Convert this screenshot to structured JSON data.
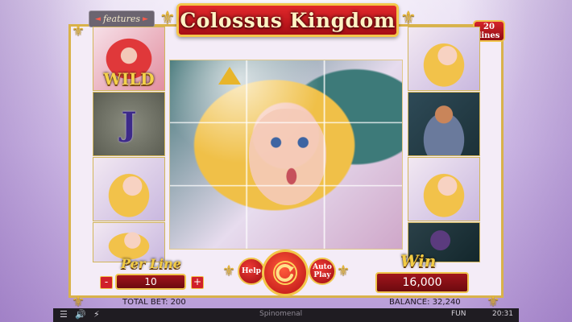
{
  "game": {
    "title": "Colossus Kingdom",
    "lines_badge": "20 lines",
    "features_label": "features",
    "wild_label": "WILD",
    "j_symbol": "J"
  },
  "reels": {
    "left": [
      "wizard-wild",
      "j",
      "princess",
      "princess"
    ],
    "center_mega": "princess-mega",
    "right": [
      "princess",
      "warrior",
      "princess",
      "dragon"
    ]
  },
  "controls": {
    "per_line_label": "Per Line",
    "per_line_value": "10",
    "minus": "-",
    "plus": "+",
    "help_label": "Help",
    "autoplay_label": "Auto Play",
    "win_label": "Win",
    "win_value": "16,000",
    "total_bet": "TOTAL BET: 200",
    "balance": "BALANCE: 32,240"
  },
  "system_bar": {
    "brand": "Spinomenal",
    "mode": "FUN",
    "time": "20:31"
  },
  "colors": {
    "banner_red": "#c41820",
    "gold": "#f0c54d",
    "background": "#d8c6ec"
  }
}
